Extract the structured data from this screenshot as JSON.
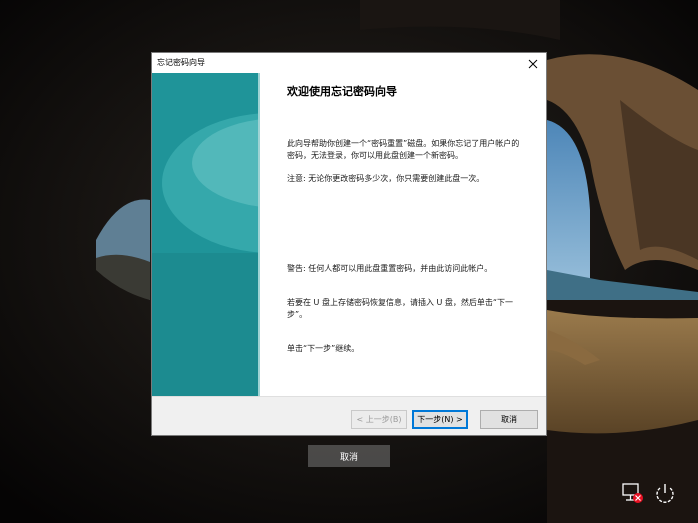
{
  "dialog": {
    "title": "忘记密码向导",
    "heading": "欢迎使用忘记密码向导",
    "paragraphs": [
      "此向导帮助你创建一个“密码重置”磁盘。如果你忘记了用户帐户的密码，无法登录，你可以用此盘创建一个新密码。",
      "注意: 无论你更改密码多少次，你只需要创建此盘一次。",
      "警告: 任何人都可以用此盘重置密码，并由此访问此帐户。",
      "若要在 U 盘上存储密码恢复信息，请插入 U 盘，然后单击“下一步”。",
      "单击“下一步”继续。"
    ],
    "buttons": {
      "back": "< 上一步(B)",
      "next": "下一步(N) >",
      "cancel": "取消"
    }
  },
  "login_screen": {
    "cancel_label": "取消"
  },
  "icons": {
    "close": "close-icon",
    "network_error": "network-disconnected-icon",
    "power": "power-icon"
  },
  "colors": {
    "accent": "#0078d7",
    "banner_teal": "#2aa9ae"
  }
}
